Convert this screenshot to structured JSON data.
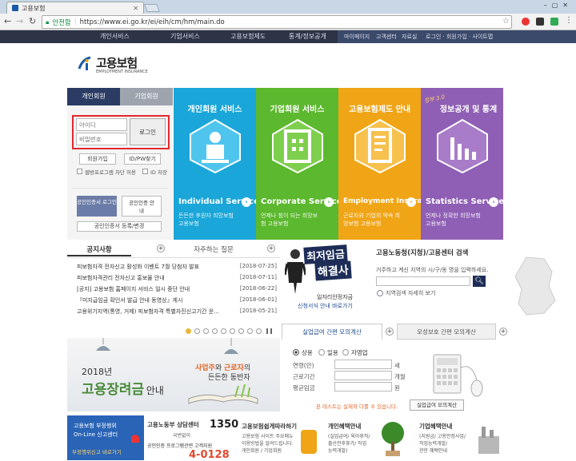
{
  "browser": {
    "tab_title": "고용보험",
    "secure_label": "안전함",
    "url": "https://www.ei.go.kr/ei/eih/cm/hm/main.do"
  },
  "gnb": {
    "items": [
      "개인서비스",
      "기업서비스",
      "고용보험제도",
      "통계/정보공개"
    ],
    "util": [
      "마이페이지",
      "고객센터",
      "자료실",
      "로그인 · 회원가입 · 사이트맵"
    ]
  },
  "logo": {
    "ko": "고용보험",
    "en": "EMPLOYMENT INSURANCE"
  },
  "login": {
    "tab_personal": "개인회원",
    "tab_company": "기업회원",
    "id_placeholder": "아이디",
    "pw_placeholder": "비밀번호",
    "login_button": "로그인",
    "join": "회원가입",
    "find": "ID/PW찾기",
    "security_check": "웹방프로그램 차단 허용",
    "save_id": "ID 저장",
    "cert_login": "공인인증서 로그인",
    "cert_guide": "공인인증 안내",
    "cert_register": "공인인증서 등록/변경"
  },
  "tiles": [
    {
      "title": "개인회원 서비스",
      "en": "Individual Service",
      "ko": "든든한 후원자 희망보험 고용보험",
      "color": "#1aa6d8"
    },
    {
      "title": "기업회원 서비스",
      "en": "Corporate Service",
      "ko": "언제나 힘이 되는 희망보험 고용보험",
      "color": "#5cb82e"
    },
    {
      "title": "고용보험제도 안내",
      "en": "Employment Insurance",
      "ko": "근로자와 기업의 약속 희망보험 고용보험",
      "color": "#f0a516"
    },
    {
      "title": "정보공개 및 통계",
      "badge": "정부 3.0",
      "en": "Statistics Service",
      "ko": "언제나 정확한 희망보험 고용보험",
      "color": "#8f5fb5"
    }
  ],
  "notice": {
    "tab1": "공지사항",
    "tab2": "자주하는 질문",
    "rows": [
      {
        "title": "피보험자격 전자신고 활성화 이벤트 7월 당첨자 발표",
        "date": "[2018-07-25]"
      },
      {
        "title": "피보험자격관리 전자신고 홍보물 안내",
        "date": "[2018-07-11]"
      },
      {
        "title": "[공지] 고용보험 홈페이지 서비스 일시 중단 안내",
        "date": "[2018-06-22]"
      },
      {
        "title": "『미지급임금 확인서 발급 안내 동영상』게시",
        "date": "[2018-06-01]"
      },
      {
        "title": "고용위기지역(통영, 거제) 피보험자격 특별자진신고기간 운...",
        "date": "[2018-05-21]"
      }
    ]
  },
  "min_wage": {
    "title_line1": "최저임금",
    "title_line2": "해결사",
    "caption1": "일자리안정자금",
    "caption2": "신청서식 안내 바로가기"
  },
  "office_search": {
    "title": "고용노동청(지청)/고용센터 검색",
    "desc": "거주하고 계신 지역의 시/구/동 명을 입력하세요.",
    "map_link": "지역검색 자세히 보기"
  },
  "banner": {
    "year": "2018년",
    "main": "고용장려금",
    "suffix": "안내",
    "sub1": "사업주",
    "sub_and": "와 ",
    "sub2": "근로자",
    "sub3": "의",
    "sub4": "든든한 동반자"
  },
  "calc": {
    "tab1": "실업급여 간편 모의계산",
    "tab2": "모성보호 간편 모의계산",
    "radios": [
      "상용",
      "일용",
      "자영업"
    ],
    "rows": [
      {
        "label": "연령(만)",
        "unit": "세"
      },
      {
        "label": "근로기간",
        "unit": "개월"
      },
      {
        "label": "평균임금",
        "unit": "원"
      }
    ],
    "notice": "본 테스트는 실제와 다를 수 있습니다.",
    "button": "실업급여 모의계산"
  },
  "bottom": {
    "fraud_line1": "고용보험 부정행위",
    "fraud_line2": "On-Line 신고센터",
    "fraud_link": "부정행위신고 바로가기",
    "call_title": "고용노동부 상담센터",
    "call_num": "1350",
    "call_area": "국번없이",
    "cert_center": "공인인증 프로그램관련 고객지원",
    "cert_num": "4-0128",
    "easy_title": "고용보험쉽게따라하기",
    "easy_desc1": "고용보험 사이트 주요메뉴",
    "easy_desc2": "이용방법을 알려드립니다.",
    "easy_desc3": "개인회원 / 기업회원",
    "personal_title": "개인혜택안내",
    "personal_desc1": "(실업급여/ 육아휴직/",
    "personal_desc2": "출산전후휴가/ 직업",
    "personal_desc3": "능력개발)",
    "company_title": "기업혜택안내",
    "company_desc1": "(지원금/ 고용안정사업/",
    "company_desc2": "직업능력개발/",
    "company_desc3": "관한 혜택안내"
  }
}
